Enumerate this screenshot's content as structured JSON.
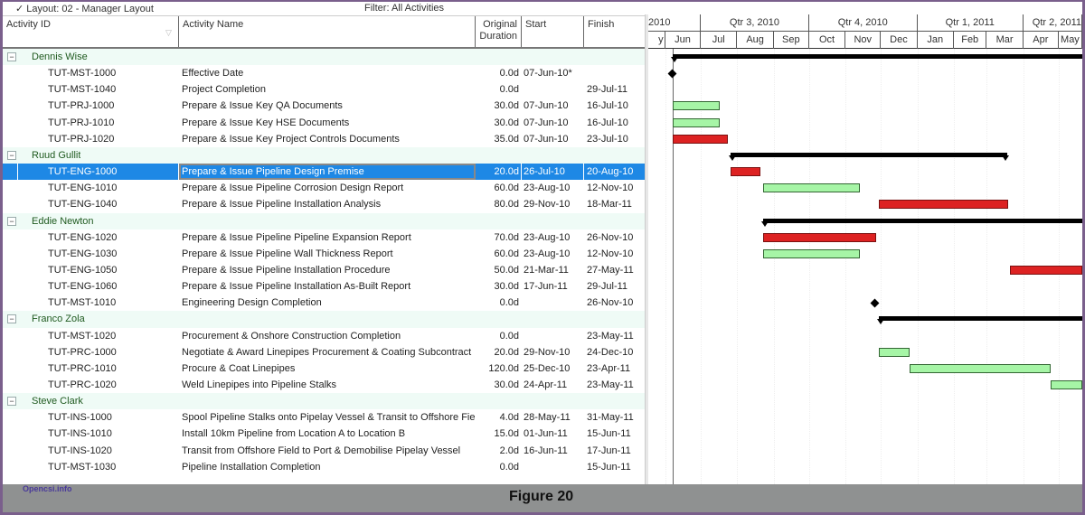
{
  "toolbar": {
    "layout_label": "✓ Layout: 02 - Manager Layout",
    "filter_label": "Filter: All Activities"
  },
  "columns": {
    "activity_id": "Activity ID",
    "activity_name": "Activity Name",
    "original_duration_line1": "Original",
    "original_duration_line2": "Duration",
    "start": "Start",
    "finish": "Finish"
  },
  "timeline": {
    "quarters": [
      {
        "label": "2010",
        "start": "2010-04-25",
        "end": "2010-07-01"
      },
      {
        "label": "Qtr 3, 2010",
        "start": "2010-07-01",
        "end": "2010-10-01"
      },
      {
        "label": "Qtr 4, 2010",
        "start": "2010-10-01",
        "end": "2011-01-01"
      },
      {
        "label": "Qtr 1, 2011",
        "start": "2011-01-01",
        "end": "2011-04-01"
      },
      {
        "label": "Qtr 2, 2011",
        "start": "2011-04-01",
        "end": "2011-07-01"
      }
    ],
    "months": [
      {
        "label": "y",
        "start": "2010-05-25",
        "end": "2010-06-01"
      },
      {
        "label": "Jun",
        "start": "2010-06-01",
        "end": "2010-07-01"
      },
      {
        "label": "Jul",
        "start": "2010-07-01",
        "end": "2010-08-01"
      },
      {
        "label": "Aug",
        "start": "2010-08-01",
        "end": "2010-09-01"
      },
      {
        "label": "Sep",
        "start": "2010-09-01",
        "end": "2010-10-01"
      },
      {
        "label": "Oct",
        "start": "2010-10-01",
        "end": "2010-11-01"
      },
      {
        "label": "Nov",
        "start": "2010-11-01",
        "end": "2010-12-01"
      },
      {
        "label": "Dec",
        "start": "2010-12-01",
        "end": "2011-01-01"
      },
      {
        "label": "Jan",
        "start": "2011-01-01",
        "end": "2011-02-01"
      },
      {
        "label": "Feb",
        "start": "2011-02-01",
        "end": "2011-03-01"
      },
      {
        "label": "Mar",
        "start": "2011-03-01",
        "end": "2011-04-01"
      },
      {
        "label": "Apr",
        "start": "2011-04-01",
        "end": "2011-05-01"
      },
      {
        "label": "May",
        "start": "2011-05-01",
        "end": "2011-06-01"
      }
    ],
    "data_date": "2010-06-07"
  },
  "groups": [
    {
      "name": "Dennis Wise",
      "summary": {
        "start": "2010-06-07",
        "finish": "2011-07-29"
      },
      "activities": [
        {
          "id": "TUT-MST-1000",
          "name": "Effective Date",
          "duration": "0.0d",
          "start": "07-Jun-10*",
          "finish": "",
          "type": "milestone",
          "s": "2010-06-07",
          "f": "2010-06-07"
        },
        {
          "id": "TUT-MST-1040",
          "name": "Project Completion",
          "duration": "0.0d",
          "start": "",
          "finish": "29-Jul-11",
          "type": "milestone",
          "s": "2011-07-29",
          "f": "2011-07-29"
        },
        {
          "id": "TUT-PRJ-1000",
          "name": "Prepare & Issue Key QA Documents",
          "duration": "30.0d",
          "start": "07-Jun-10",
          "finish": "16-Jul-10",
          "type": "green",
          "s": "2010-06-07",
          "f": "2010-07-16"
        },
        {
          "id": "TUT-PRJ-1010",
          "name": "Prepare & Issue Key HSE Documents",
          "duration": "30.0d",
          "start": "07-Jun-10",
          "finish": "16-Jul-10",
          "type": "green",
          "s": "2010-06-07",
          "f": "2010-07-16"
        },
        {
          "id": "TUT-PRJ-1020",
          "name": "Prepare & Issue Key Project Controls Documents",
          "duration": "35.0d",
          "start": "07-Jun-10",
          "finish": "23-Jul-10",
          "type": "red",
          "s": "2010-06-07",
          "f": "2010-07-23"
        }
      ]
    },
    {
      "name": "Ruud Gullit",
      "summary": {
        "start": "2010-07-26",
        "finish": "2011-03-18"
      },
      "activities": [
        {
          "id": "TUT-ENG-1000",
          "name": "Prepare & Issue Pipeline Design Premise",
          "duration": "20.0d",
          "start": "26-Jul-10",
          "finish": "20-Aug-10",
          "type": "red",
          "s": "2010-07-26",
          "f": "2010-08-20",
          "selected": true
        },
        {
          "id": "TUT-ENG-1010",
          "name": "Prepare & Issue Pipeline Corrosion Design Report",
          "duration": "60.0d",
          "start": "23-Aug-10",
          "finish": "12-Nov-10",
          "type": "green",
          "s": "2010-08-23",
          "f": "2010-11-12"
        },
        {
          "id": "TUT-ENG-1040",
          "name": "Prepare & Issue Pipeline Installation Analysis",
          "duration": "80.0d",
          "start": "29-Nov-10",
          "finish": "18-Mar-11",
          "type": "red",
          "s": "2010-11-29",
          "f": "2011-03-18"
        }
      ]
    },
    {
      "name": "Eddie Newton",
      "summary": {
        "start": "2010-08-23",
        "finish": "2011-07-29"
      },
      "activities": [
        {
          "id": "TUT-ENG-1020",
          "name": "Prepare & Issue Pipeline Pipeline Expansion Report",
          "duration": "70.0d",
          "start": "23-Aug-10",
          "finish": "26-Nov-10",
          "type": "red",
          "s": "2010-08-23",
          "f": "2010-11-26"
        },
        {
          "id": "TUT-ENG-1030",
          "name": "Prepare & Issue Pipeline Wall Thickness Report",
          "duration": "60.0d",
          "start": "23-Aug-10",
          "finish": "12-Nov-10",
          "type": "green",
          "s": "2010-08-23",
          "f": "2010-11-12"
        },
        {
          "id": "TUT-ENG-1050",
          "name": "Prepare & Issue Pipeline Installation Procedure",
          "duration": "50.0d",
          "start": "21-Mar-11",
          "finish": "27-May-11",
          "type": "red",
          "s": "2011-03-21",
          "f": "2011-05-27"
        },
        {
          "id": "TUT-ENG-1060",
          "name": "Prepare & Issue Pipeline Installation As-Built Report",
          "duration": "30.0d",
          "start": "17-Jun-11",
          "finish": "29-Jul-11",
          "type": "red",
          "s": "2011-06-17",
          "f": "2011-07-29"
        },
        {
          "id": "TUT-MST-1010",
          "name": "Engineering Design Completion",
          "duration": "0.0d",
          "start": "",
          "finish": "26-Nov-10",
          "type": "milestone",
          "s": "2010-11-26",
          "f": "2010-11-26"
        }
      ]
    },
    {
      "name": "Franco Zola",
      "summary": {
        "start": "2010-11-29",
        "finish": "2011-05-23"
      },
      "activities": [
        {
          "id": "TUT-MST-1020",
          "name": "Procurement & Onshore Construction Completion",
          "duration": "0.0d",
          "start": "",
          "finish": "23-May-11",
          "type": "milestone",
          "s": "2011-05-23",
          "f": "2011-05-23"
        },
        {
          "id": "TUT-PRC-1000",
          "name": "Negotiate & Award Linepipes Procurement & Coating Subcontract",
          "duration": "20.0d",
          "start": "29-Nov-10",
          "finish": "24-Dec-10",
          "type": "green",
          "s": "2010-11-29",
          "f": "2010-12-24"
        },
        {
          "id": "TUT-PRC-1010",
          "name": "Procure & Coat Linepipes",
          "duration": "120.0d",
          "start": "25-Dec-10",
          "finish": "23-Apr-11",
          "type": "green",
          "s": "2010-12-25",
          "f": "2011-04-23"
        },
        {
          "id": "TUT-PRC-1020",
          "name": "Weld Linepipes into Pipeline Stalks",
          "duration": "30.0d",
          "start": "24-Apr-11",
          "finish": "23-May-11",
          "type": "green",
          "s": "2011-04-24",
          "f": "2011-05-23"
        }
      ]
    },
    {
      "name": "Steve Clark",
      "summary": null,
      "activities": [
        {
          "id": "TUT-INS-1000",
          "name": "Spool Pipeline Stalks onto Pipelay Vessel & Transit to Offshore Field",
          "duration": "4.0d",
          "start": "28-May-11",
          "finish": "31-May-11",
          "type": "green",
          "s": "2011-05-28",
          "f": "2011-05-31"
        },
        {
          "id": "TUT-INS-1010",
          "name": "Install 10km Pipeline from Location A to Location B",
          "duration": "15.0d",
          "start": "01-Jun-11",
          "finish": "15-Jun-11",
          "type": "green",
          "s": "2011-06-01",
          "f": "2011-06-15"
        },
        {
          "id": "TUT-INS-1020",
          "name": "Transit from Offshore Field to Port & Demobilise Pipelay Vessel",
          "duration": "2.0d",
          "start": "16-Jun-11",
          "finish": "17-Jun-11",
          "type": "green",
          "s": "2011-06-16",
          "f": "2011-06-17"
        },
        {
          "id": "TUT-MST-1030",
          "name": "Pipeline Installation Completion",
          "duration": "0.0d",
          "start": "",
          "finish": "15-Jun-11",
          "type": "milestone",
          "s": "2011-06-15",
          "f": "2011-06-15"
        }
      ]
    }
  ],
  "footer": {
    "site": "Opencsi.info",
    "caption": "Figure 20"
  }
}
